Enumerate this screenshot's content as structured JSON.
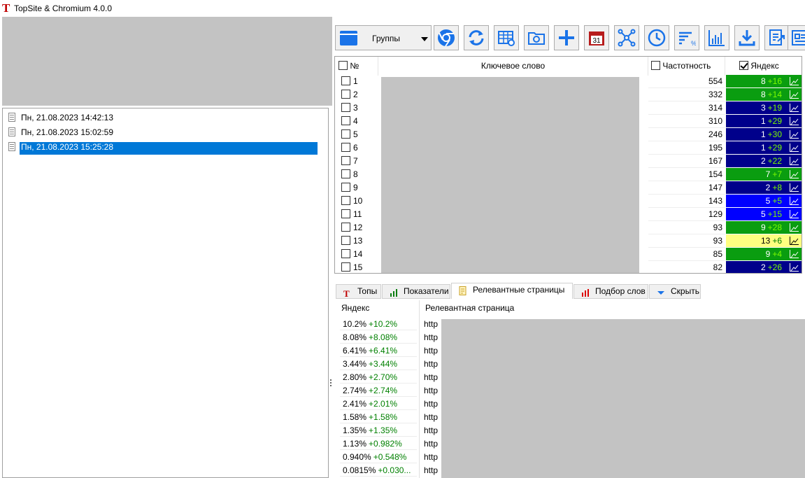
{
  "app": {
    "logo": "T",
    "title": "TopSite & Chromium 4.0.0"
  },
  "history": [
    {
      "label": "Пн, 21.08.2023 14:42:13",
      "selected": false
    },
    {
      "label": "Пн, 21.08.2023 15:02:59",
      "selected": false
    },
    {
      "label": "Пн, 21.08.2023 15:25:28",
      "selected": true
    }
  ],
  "toolbar": {
    "groups_label": "Группы",
    "buttons": [
      "chromium-icon",
      "refresh-icon",
      "table-settings-icon",
      "folder-settings-icon",
      "add-icon",
      "calendar-icon",
      "network-icon",
      "clock-icon",
      "sort-percent-icon",
      "chart-icon",
      "download-icon",
      "export-icon",
      "layout-icon"
    ],
    "calendar_day": "31"
  },
  "table": {
    "headers": {
      "num": "№",
      "keyword": "Ключевое слово",
      "freq": "Частотность",
      "yandex": "Яндекс"
    },
    "yandex_checked": true,
    "rows": [
      {
        "n": "1",
        "freq": "554",
        "pos": "8",
        "delta": "+16",
        "color": "green"
      },
      {
        "n": "2",
        "freq": "332",
        "pos": "8",
        "delta": "+14",
        "color": "green"
      },
      {
        "n": "3",
        "freq": "314",
        "pos": "3",
        "delta": "+19",
        "color": "navy"
      },
      {
        "n": "4",
        "freq": "310",
        "pos": "1",
        "delta": "+29",
        "color": "navy"
      },
      {
        "n": "5",
        "freq": "246",
        "pos": "1",
        "delta": "+30",
        "color": "navy"
      },
      {
        "n": "6",
        "freq": "195",
        "pos": "1",
        "delta": "+29",
        "color": "navy"
      },
      {
        "n": "7",
        "freq": "167",
        "pos": "2",
        "delta": "+22",
        "color": "navy"
      },
      {
        "n": "8",
        "freq": "154",
        "pos": "7",
        "delta": "+7",
        "color": "green"
      },
      {
        "n": "9",
        "freq": "147",
        "pos": "2",
        "delta": "+8",
        "color": "navy"
      },
      {
        "n": "10",
        "freq": "143",
        "pos": "5",
        "delta": "+5",
        "color": "blue"
      },
      {
        "n": "11",
        "freq": "129",
        "pos": "5",
        "delta": "+15",
        "color": "blue"
      },
      {
        "n": "12",
        "freq": "93",
        "pos": "9",
        "delta": "+28",
        "color": "green"
      },
      {
        "n": "13",
        "freq": "93",
        "pos": "13",
        "delta": "+6",
        "color": "yellow"
      },
      {
        "n": "14",
        "freq": "85",
        "pos": "9",
        "delta": "+4",
        "color": "green"
      },
      {
        "n": "15",
        "freq": "82",
        "pos": "2",
        "delta": "+26",
        "color": "navy"
      }
    ],
    "colors": {
      "green": "#0a9d10",
      "navy": "#00008b",
      "blue": "#0000ff",
      "yellow": "#ffff80"
    }
  },
  "tabs": [
    {
      "label": "Топы",
      "icon": "topsite-icon",
      "active": false
    },
    {
      "label": "Показатели",
      "icon": "bars-icon",
      "active": false
    },
    {
      "label": "Релевантные страницы",
      "icon": "document-icon",
      "active": true
    },
    {
      "label": "Подбор слов",
      "icon": "red-bars-icon",
      "active": false
    },
    {
      "label": "Скрыть",
      "icon": "hide-arrow-icon",
      "active": false
    }
  ],
  "relevant": {
    "headers": {
      "yandex": "Яндекс",
      "page": "Релевантная страница"
    },
    "rows": [
      {
        "pct": "10.2%",
        "delta": "+10.2%",
        "url": "http"
      },
      {
        "pct": "8.08%",
        "delta": "+8.08%",
        "url": "http"
      },
      {
        "pct": "6.41%",
        "delta": "+6.41%",
        "url": "http"
      },
      {
        "pct": "3.44%",
        "delta": "+3.44%",
        "url": "http"
      },
      {
        "pct": "2.80%",
        "delta": "+2.70%",
        "url": "http"
      },
      {
        "pct": "2.74%",
        "delta": "+2.74%",
        "url": "http"
      },
      {
        "pct": "2.41%",
        "delta": "+2.01%",
        "url": "http"
      },
      {
        "pct": "1.58%",
        "delta": "+1.58%",
        "url": "http"
      },
      {
        "pct": "1.35%",
        "delta": "+1.35%",
        "url": "http"
      },
      {
        "pct": "1.13%",
        "delta": "+0.982%",
        "url": "http"
      },
      {
        "pct": "0.940%",
        "delta": "+0.548%",
        "url": "http"
      },
      {
        "pct": "0.0815%",
        "delta": "+0.030...",
        "url": "http"
      }
    ]
  }
}
